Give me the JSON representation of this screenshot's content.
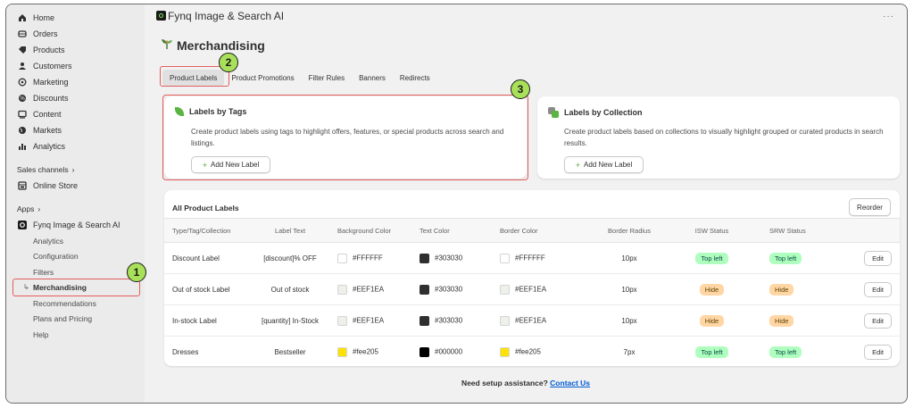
{
  "sidebar": {
    "main_items": [
      {
        "label": "Home",
        "icon": "home-icon"
      },
      {
        "label": "Orders",
        "icon": "orders-icon"
      },
      {
        "label": "Products",
        "icon": "products-icon"
      },
      {
        "label": "Customers",
        "icon": "customers-icon"
      },
      {
        "label": "Marketing",
        "icon": "marketing-icon"
      },
      {
        "label": "Discounts",
        "icon": "discounts-icon"
      },
      {
        "label": "Content",
        "icon": "content-icon"
      },
      {
        "label": "Markets",
        "icon": "markets-icon"
      },
      {
        "label": "Analytics",
        "icon": "analytics-icon"
      }
    ],
    "sales_channels_label": "Sales channels",
    "online_store": "Online Store",
    "apps_label": "Apps",
    "app_name": "Fynq Image & Search AI",
    "app_sub_items": [
      "Analytics",
      "Configuration",
      "Filters",
      "Merchandising",
      "Recommendations",
      "Plans and Pricing",
      "Help"
    ]
  },
  "header": {
    "app_title": "Fynq Image & Search AI",
    "more": "···"
  },
  "page": {
    "title": "Merchandising"
  },
  "tabs": [
    "Product Labels",
    "Product Promotions",
    "Filter Rules",
    "Banners",
    "Redirects"
  ],
  "callouts": [
    "1",
    "2",
    "3"
  ],
  "cards": {
    "tags": {
      "title": "Labels by Tags",
      "desc": "Create product labels using tags to highlight offers, features, or special products across search and listings.",
      "button": "Add New Label"
    },
    "collection": {
      "title": "Labels by Collection",
      "desc": "Create product labels based on collections to visually highlight grouped or curated products in search results.",
      "button": "Add New Label"
    }
  },
  "table": {
    "title": "All Product Labels",
    "reorder": "Reorder",
    "headers": [
      "Type/Tag/Collection",
      "Label Text",
      "Background Color",
      "Text Color",
      "Border Color",
      "Border Radius",
      "ISW Status",
      "SRW Status"
    ],
    "rows": [
      {
        "type": "Discount Label",
        "text": "[discount]% OFF",
        "bg": "#FFFFFF",
        "fg": "#303030",
        "border": "#FFFFFF",
        "radius": "10px",
        "isw": "Top left",
        "isw_color": "green",
        "srw": "Top left",
        "srw_color": "green",
        "edit": "Edit"
      },
      {
        "type": "Out of stock Label",
        "text": "Out of stock",
        "bg": "#EEF1EA",
        "fg": "#303030",
        "border": "#EEF1EA",
        "radius": "10px",
        "isw": "Hide",
        "isw_color": "orange",
        "srw": "Hide",
        "srw_color": "orange",
        "edit": "Edit"
      },
      {
        "type": "In-stock Label",
        "text": "[quantity] In-Stock",
        "bg": "#EEF1EA",
        "fg": "#303030",
        "border": "#EEF1EA",
        "radius": "10px",
        "isw": "Hide",
        "isw_color": "orange",
        "srw": "Hide",
        "srw_color": "orange",
        "edit": "Edit"
      },
      {
        "type": "Dresses",
        "text": "Bestseller",
        "bg": "#fee205",
        "fg": "#000000",
        "border": "#fee205",
        "radius": "7px",
        "isw": "Top left",
        "isw_color": "green",
        "srw": "Top left",
        "srw_color": "green",
        "edit": "Edit"
      }
    ]
  },
  "footer": {
    "text": "Need setup assistance?",
    "link": "Contact Us"
  }
}
